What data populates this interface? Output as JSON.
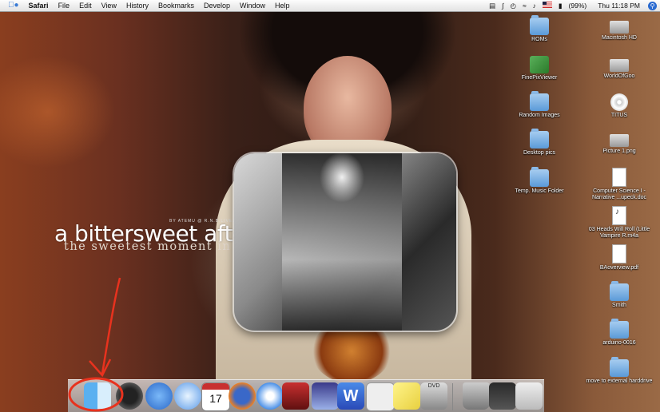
{
  "menubar": {
    "app_name": "Safari",
    "menus": [
      "File",
      "Edit",
      "View",
      "History",
      "Bookmarks",
      "Develop",
      "Window",
      "Help"
    ],
    "battery": "(99%)",
    "clock": "Thu 11:18 PM"
  },
  "wallpaper": {
    "by_line": "BY ATEMU @ R.N.B.LIVEJOURNAL.COM",
    "title": "a bittersweet aftertaste",
    "subtitle": "the sweetest moment in your life"
  },
  "desktop_icons": {
    "col1": [
      {
        "label": "ROMs",
        "icon": "folder-icon"
      },
      {
        "label": "FinePixViewer",
        "icon": "app-icon"
      },
      {
        "label": "Random Images",
        "icon": "folder-icon"
      },
      {
        "label": "Desktop pics",
        "icon": "folder-icon"
      },
      {
        "label": "Temp. Music Folder",
        "icon": "folder-icon"
      }
    ],
    "col2": [
      {
        "label": "Macintosh HD",
        "icon": "hard-drive-icon"
      },
      {
        "label": "WorldOfGoo",
        "icon": "disk-image-icon"
      },
      {
        "label": "TITUS",
        "icon": "dvd-icon"
      },
      {
        "label": "Picture 1.png",
        "icon": "image-file-icon"
      },
      {
        "label": "Computer Science I - Narrative ...upeck.doc",
        "icon": "document-icon"
      },
      {
        "label": "03 Heads Will Roll (Little Vampire R.m4a",
        "icon": "music-file-icon"
      },
      {
        "label": "BAoverview.pdf",
        "icon": "pdf-icon"
      },
      {
        "label": "Smith",
        "icon": "folder-icon"
      },
      {
        "label": "arduino-0016",
        "icon": "folder-icon"
      },
      {
        "label": "move to external harddrive",
        "icon": "folder-icon"
      }
    ]
  },
  "dock": {
    "ical_day": "17",
    "word_letter": "W",
    "dvd_label": "DVD"
  },
  "colors": {
    "annotation_red": "#e8321e",
    "folder_blue": "#5a9ad8"
  }
}
